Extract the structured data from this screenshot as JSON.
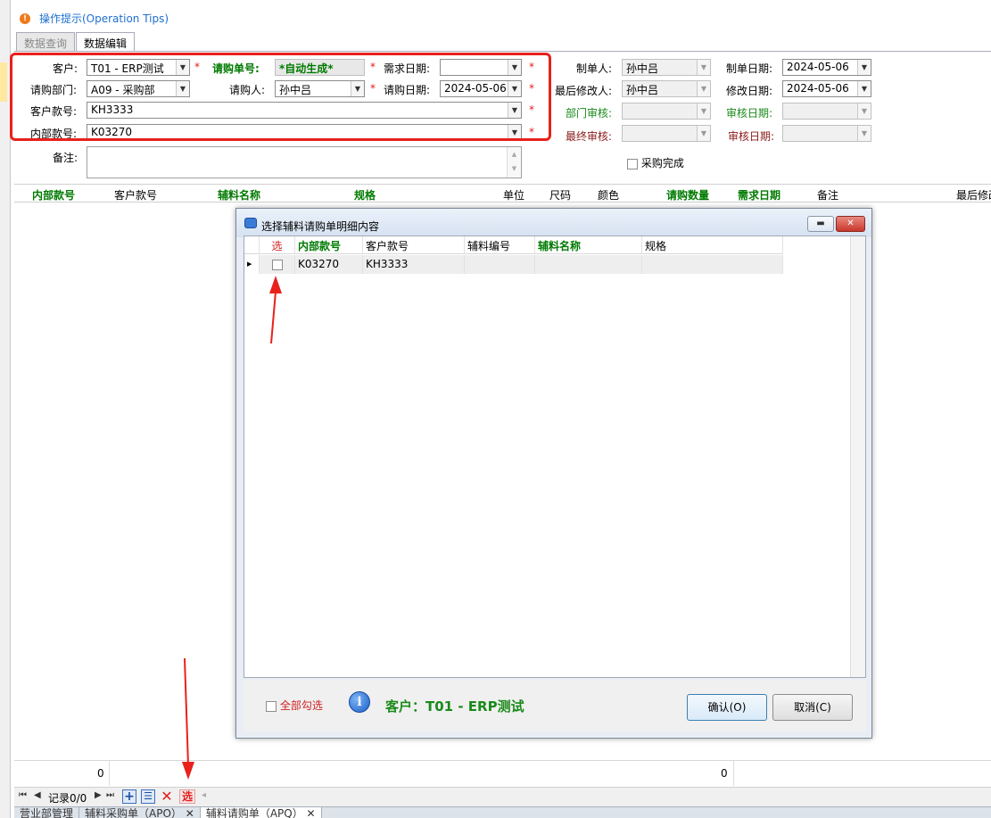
{
  "header": {
    "tips_icon": "warning-icon",
    "tips_label": "操作提示(Operation Tips)",
    "tabs": [
      "数据查询",
      "数据编辑"
    ],
    "active_tab": 1
  },
  "form": {
    "customer_label": "客户:",
    "customer_value": "T01 - ERP测试",
    "order_no_label": "请购单号:",
    "order_no_value": "*自动生成*",
    "demand_date_label": "需求日期:",
    "demand_date_value": "",
    "dept_label": "请购部门:",
    "dept_value": "A09 - 采购部",
    "requester_label": "请购人:",
    "requester_value": "孙中吕",
    "request_date_label": "请购日期:",
    "request_date_value": "2024-05-06",
    "cust_style_label": "客户款号:",
    "cust_style_value": "KH3333",
    "inner_style_label": "内部款号:",
    "inner_style_value": "K03270",
    "remark_label": "备注:",
    "remark_value": "",
    "required_mark": "*",
    "creator_label": "制单人:",
    "creator_value": "孙中吕",
    "create_date_label": "制单日期:",
    "create_date_value": "2024-05-06",
    "last_editor_label": "最后修改人:",
    "last_editor_value": "孙中吕",
    "edit_date_label": "修改日期:",
    "edit_date_value": "2024-05-06",
    "dept_audit_label": "部门审核:",
    "dept_audit_value": "",
    "audit_date_label": "审核日期:",
    "audit_date_value": "",
    "final_audit_label": "最终审核:",
    "final_audit_value": "",
    "final_audit_date_label": "审核日期:",
    "final_audit_date_value": "",
    "purchase_done_label": "采购完成",
    "purchase_done_checked": false
  },
  "grid": {
    "columns": [
      "内部款号",
      "客户款号",
      "辅料名称",
      "规格",
      "单位",
      "尺码",
      "颜色",
      "请购数量",
      "需求日期",
      "备注",
      "最后修改"
    ],
    "rows": []
  },
  "footer": {
    "total_left": "0",
    "total_right": "0",
    "record_label": "记录0/0",
    "select_button": "选"
  },
  "bottom_tabs": [
    "营业部管理",
    "辅料采购单（APO）",
    "辅料请购单（APQ）"
  ],
  "dialog": {
    "title": "选择辅料请购单明细内容",
    "columns": [
      "选",
      "内部款号",
      "客户款号",
      "辅料编号",
      "辅料名称",
      "规格"
    ],
    "rows": [
      {
        "selected": false,
        "inner_style": "K03270",
        "cust_style": "KH3333",
        "material_code": "",
        "material_name": "",
        "spec": ""
      }
    ],
    "select_all_label": "全部勾选",
    "customer_info": "客户：T01 - ERP测试",
    "ok_label": "确认(O)",
    "cancel_label": "取消(C)",
    "minimize_icon": "minimize-icon",
    "close_icon": "close-icon",
    "info_icon": "info-icon"
  },
  "colors": {
    "highlight_box": "#e8211a",
    "green_label": "#007a00",
    "required": "#e02020",
    "link_blue": "#1e6fd0"
  }
}
